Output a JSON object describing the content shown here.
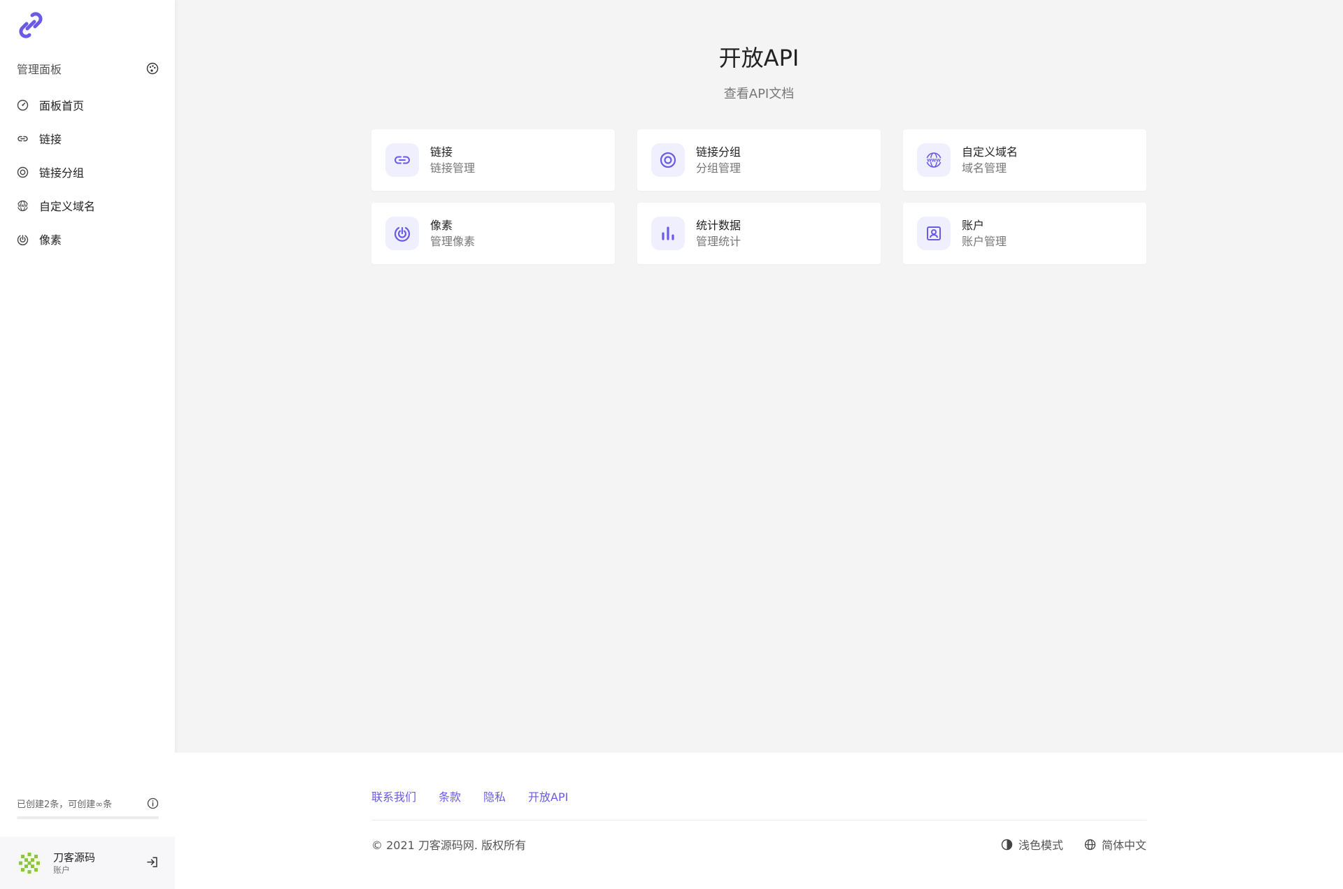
{
  "colors": {
    "accent": "#6a5ae8",
    "accent_soft": "#efeffd",
    "sidebar_bg": "#ffffff",
    "main_bg": "#f4f4f4"
  },
  "sidebar": {
    "header_label": "管理面板",
    "header_icon": "palette-icon",
    "nav": [
      {
        "label": "面板首页",
        "icon": "speedometer-icon"
      },
      {
        "label": "链接",
        "icon": "link-icon"
      },
      {
        "label": "链接分组",
        "icon": "target-icon"
      },
      {
        "label": "自定义域名",
        "icon": "www-icon"
      },
      {
        "label": "像素",
        "icon": "pixel-icon"
      }
    ],
    "usage": {
      "text": "已创建2条，可创建∞条",
      "progress_percent": 0
    },
    "user": {
      "name": "刀客源码",
      "role": "账户"
    }
  },
  "main": {
    "title": "开放API",
    "subtitle": "查看API文档",
    "cards": [
      {
        "title": "链接",
        "desc": "链接管理",
        "icon": "link-icon"
      },
      {
        "title": "链接分组",
        "desc": "分组管理",
        "icon": "target-icon"
      },
      {
        "title": "自定义域名",
        "desc": "域名管理",
        "icon": "www-icon"
      },
      {
        "title": "像素",
        "desc": "管理像素",
        "icon": "pixel-icon"
      },
      {
        "title": "统计数据",
        "desc": "管理统计",
        "icon": "bar-chart-icon"
      },
      {
        "title": "账户",
        "desc": "账户管理",
        "icon": "account-icon"
      }
    ]
  },
  "footer": {
    "links": [
      "联系我们",
      "条款",
      "隐私",
      "开放API"
    ],
    "copyright": "© 2021 刀客源码网. 版权所有",
    "theme_label": "浅色模式",
    "language_label": "简体中文"
  }
}
